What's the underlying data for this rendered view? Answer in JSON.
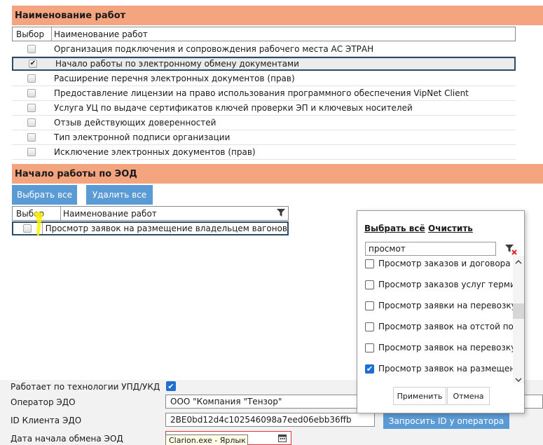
{
  "works_section": {
    "title": "Наименование работ",
    "col_select": "Выбор",
    "col_name": "Наименование работ",
    "items": [
      {
        "label": "Организация подключения и сопровождения рабочего места АС ЭТРАН",
        "checked": false
      },
      {
        "label": "Начало работы по электронному обмену документами",
        "checked": true
      },
      {
        "label": "Расширение перечня электронных документов (прав)",
        "checked": false
      },
      {
        "label": "Предоставление лицензии на право использования программного обеспечения VipNet Client",
        "checked": false
      },
      {
        "label": "Услуга УЦ по выдаче сертификатов ключей проверки ЭП и ключевых носителей",
        "checked": false
      },
      {
        "label": "Отзыв действующих доверенностей",
        "checked": false
      },
      {
        "label": "Тип электронной подписи организации",
        "checked": false
      },
      {
        "label": "Исключение электронных документов (прав)",
        "checked": false
      }
    ]
  },
  "eod_section": {
    "title": "Начало работы по ЭОД",
    "select_all": "Выбрать все",
    "delete_all": "Удалить все",
    "col_select": "Выбор",
    "col_name": "Наименование работ",
    "rows": [
      {
        "label": "Просмотр заявок на размещение владельцем вагонов"
      }
    ]
  },
  "filter_popup": {
    "select_all": "Выбрать всё",
    "clear": "Очистить",
    "search_value": "просмот",
    "options": [
      {
        "label": "Просмотр заказов и договора на",
        "checked": false
      },
      {
        "label": "Просмотр заказов услуг термин",
        "checked": false
      },
      {
        "label": "Просмотр заявки на перевозку (",
        "checked": false
      },
      {
        "label": "Просмотр заявок на отстой пор",
        "checked": false
      },
      {
        "label": "Просмотр заявок на перевозку (",
        "checked": false
      },
      {
        "label": "Просмотр заявок на размещени",
        "checked": true
      }
    ],
    "apply": "Применить",
    "cancel": "Отмена"
  },
  "form": {
    "upd_label": "Работает по технологии УПД/УКД",
    "upd_checked": true,
    "operator_label": "Оператор ЭДО",
    "operator_value": "ООО \"Компания \"Тензор\"",
    "client_id_label": "ID Клиента ЭДО",
    "client_id_value": "2BE0bd12d4c102546098a7eed06ebb36ffb",
    "request_id_button": "Запросить ID у оператора",
    "start_date_label": "Дата начала обмена ЭОД",
    "tooltip": "Clarion.exe - Ярлык"
  },
  "colors": {
    "section_header": "#f4a57f",
    "button_blue": "#5b9bd5",
    "highlight_yellow": "#fff200",
    "selection_border": "#2d4a66"
  },
  "icons": [
    "checkmark-icon",
    "filter-icon",
    "clear-filter-icon",
    "scroll-up-icon",
    "scroll-down-icon",
    "calendar-icon"
  ]
}
